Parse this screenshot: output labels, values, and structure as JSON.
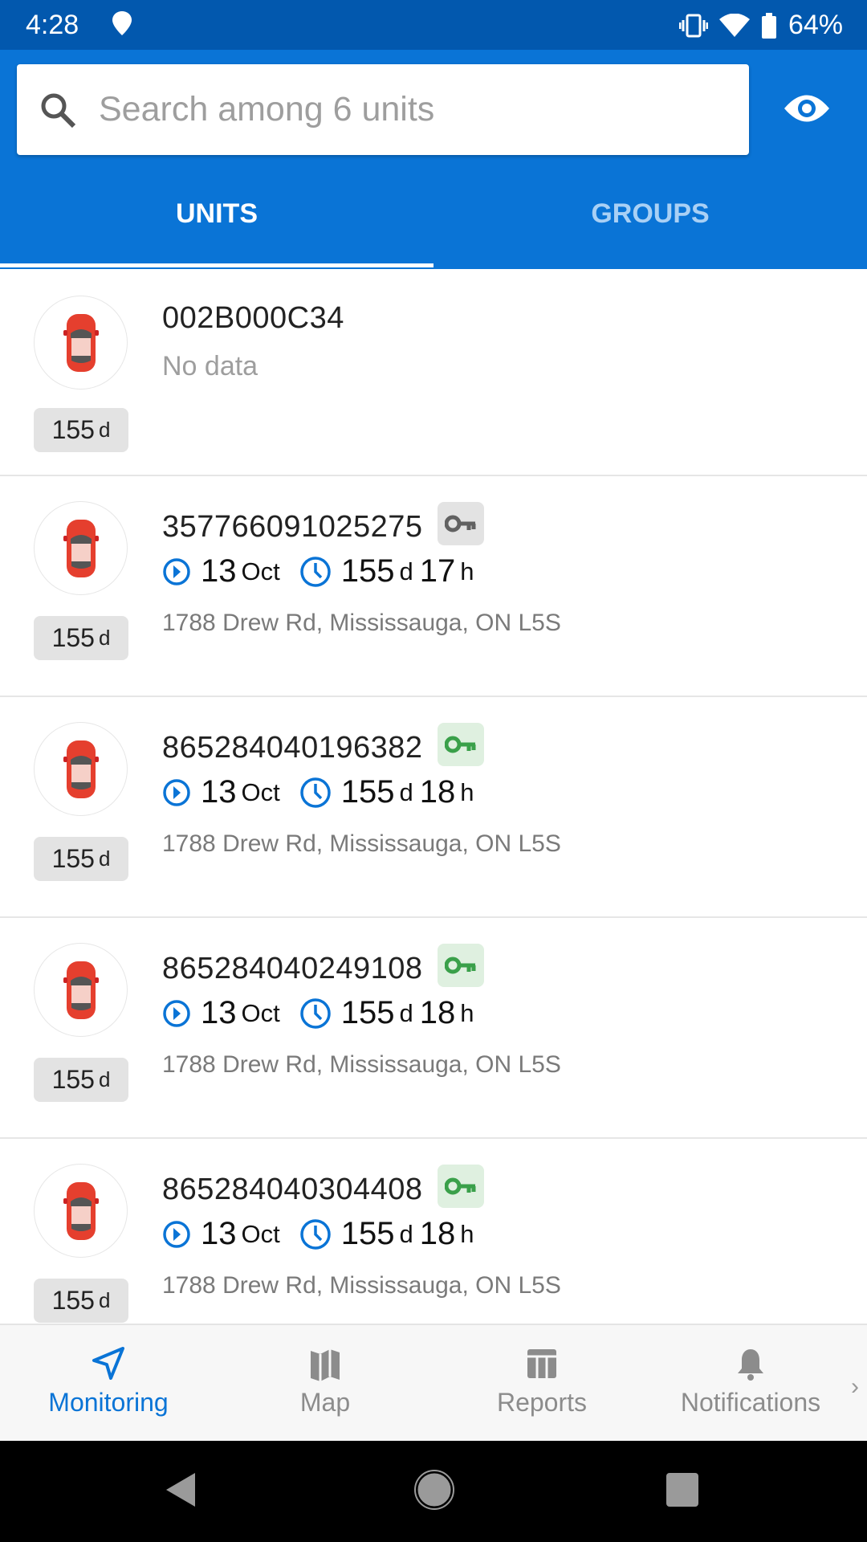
{
  "status_bar": {
    "time": "4:28",
    "battery": "64%"
  },
  "search": {
    "placeholder": "Search among 6 units"
  },
  "tabs": [
    {
      "label": "UNITS",
      "active": true
    },
    {
      "label": "GROUPS",
      "active": false
    }
  ],
  "units": [
    {
      "name": "002B000C34",
      "no_data": "No data",
      "badge_value": "155",
      "badge_unit": "d"
    },
    {
      "name": "357766091025275",
      "key_color": "#616161",
      "key_bg": "#e3e3e3",
      "date_day": "13",
      "date_month": "Oct",
      "dur_d": "155",
      "dur_d_unit": "d",
      "dur_h": "17",
      "dur_h_unit": "h",
      "address": "1788 Drew Rd, Mississauga, ON L5S",
      "badge_value": "155",
      "badge_unit": "d"
    },
    {
      "name": "865284040196382",
      "key_color": "#3aa04a",
      "key_bg": "#dff0e0",
      "date_day": "13",
      "date_month": "Oct",
      "dur_d": "155",
      "dur_d_unit": "d",
      "dur_h": "18",
      "dur_h_unit": "h",
      "address": "1788 Drew Rd, Mississauga, ON L5S",
      "badge_value": "155",
      "badge_unit": "d"
    },
    {
      "name": "865284040249108",
      "key_color": "#3aa04a",
      "key_bg": "#dff0e0",
      "date_day": "13",
      "date_month": "Oct",
      "dur_d": "155",
      "dur_d_unit": "d",
      "dur_h": "18",
      "dur_h_unit": "h",
      "address": "1788 Drew Rd, Mississauga, ON L5S",
      "badge_value": "155",
      "badge_unit": "d"
    },
    {
      "name": "865284040304408",
      "key_color": "#3aa04a",
      "key_bg": "#dff0e0",
      "date_day": "13",
      "date_month": "Oct",
      "dur_d": "155",
      "dur_d_unit": "d",
      "dur_h": "18",
      "dur_h_unit": "h",
      "address": "1788 Drew Rd, Mississauga, ON L5S",
      "badge_value": "155",
      "badge_unit": "d"
    }
  ],
  "bottom_nav": [
    {
      "label": "Monitoring",
      "icon": "navigation-arrow-icon",
      "active": true
    },
    {
      "label": "Map",
      "icon": "map-icon"
    },
    {
      "label": "Reports",
      "icon": "table-icon"
    },
    {
      "label": "Notifications",
      "icon": "bell-icon"
    }
  ],
  "colors": {
    "header": "#0a74d6",
    "status_bar": "#0258ae",
    "accent": "#0a74d6"
  }
}
